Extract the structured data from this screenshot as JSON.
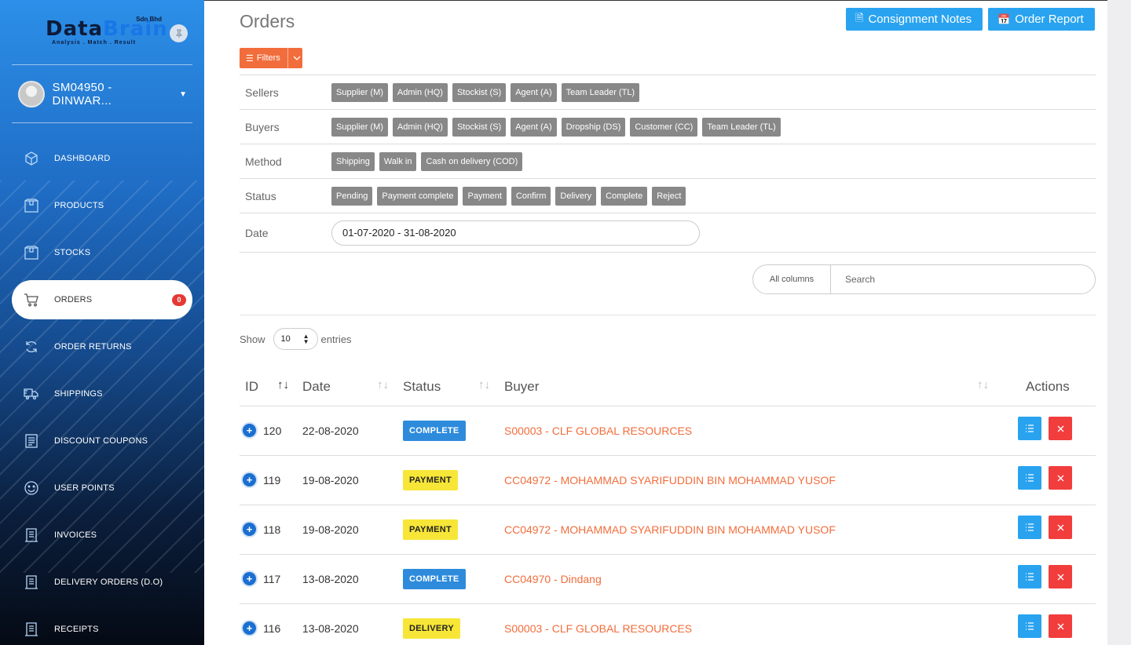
{
  "sidebar": {
    "logo": {
      "brand_dark": "Data",
      "brand_blue": "Brain",
      "sdn": "Sdn Bhd",
      "tagline": "Analysis . Match . Result"
    },
    "user_name": "SM04950 - DINWAR...",
    "items": [
      {
        "label": "DASHBOARD",
        "icon": "cube-icon"
      },
      {
        "label": "PRODUCTS",
        "icon": "box-icon"
      },
      {
        "label": "STOCKS",
        "icon": "box-icon"
      },
      {
        "label": "ORDERS",
        "icon": "cart-icon",
        "badge": "0",
        "active": true
      },
      {
        "label": "ORDER RETURNS",
        "icon": "refresh-icon"
      },
      {
        "label": "SHIPPINGS",
        "icon": "truck-icon"
      },
      {
        "label": "DISCOUNT COUPONS",
        "icon": "coupon-icon"
      },
      {
        "label": "USER POINTS",
        "icon": "smile-icon"
      },
      {
        "label": "INVOICES",
        "icon": "document-icon"
      },
      {
        "label": "DELIVERY ORDERS (D.O)",
        "icon": "document-icon"
      },
      {
        "label": "RECEIPTS",
        "icon": "document-icon"
      }
    ]
  },
  "header": {
    "title": "Orders",
    "consignment_label": "Consignment Notes",
    "report_label": "Order Report"
  },
  "filters": {
    "button_label": "Filters",
    "sellers_label": "Sellers",
    "sellers": [
      "Supplier (M)",
      "Admin (HQ)",
      "Stockist (S)",
      "Agent (A)",
      "Team Leader (TL)"
    ],
    "buyers_label": "Buyers",
    "buyers": [
      "Supplier (M)",
      "Admin (HQ)",
      "Stockist (S)",
      "Agent (A)",
      "Dropship (DS)",
      "Customer (CC)",
      "Team Leader (TL)"
    ],
    "method_label": "Method",
    "methods": [
      "Shipping",
      "Walk in",
      "Cash on delivery (COD)"
    ],
    "status_label": "Status",
    "statuses": [
      "Pending",
      "Payment complete",
      "Payment",
      "Confirm",
      "Delivery",
      "Complete",
      "Reject"
    ],
    "date_label": "Date",
    "date_value": "01-07-2020 - 31-08-2020"
  },
  "search": {
    "columns_label": "All columns",
    "placeholder": "Search"
  },
  "entries": {
    "show_label": "Show",
    "value": "10",
    "suffix": "entries"
  },
  "table": {
    "headers": {
      "id": "ID",
      "date": "Date",
      "status": "Status",
      "buyer": "Buyer",
      "actions": "Actions"
    },
    "rows": [
      {
        "id": "120",
        "date": "22-08-2020",
        "status": "COMPLETE",
        "buyer": "S00003 - CLF GLOBAL RESOURCES"
      },
      {
        "id": "119",
        "date": "19-08-2020",
        "status": "PAYMENT",
        "buyer": "CC04972 - MOHAMMAD SYARIFUDDIN BIN MOHAMMAD YUSOF"
      },
      {
        "id": "118",
        "date": "19-08-2020",
        "status": "PAYMENT",
        "buyer": "CC04972 - MOHAMMAD SYARIFUDDIN BIN MOHAMMAD YUSOF"
      },
      {
        "id": "117",
        "date": "13-08-2020",
        "status": "COMPLETE",
        "buyer": "CC04970 - Dindang"
      },
      {
        "id": "116",
        "date": "13-08-2020",
        "status": "DELIVERY",
        "buyer": "S00003 - CLF GLOBAL RESOURCES"
      }
    ]
  },
  "colors": {
    "accent_blue": "#29a3f0",
    "accent_orange": "#f26d3c",
    "status_complete": "#2e8bdc",
    "status_payment": "#f7e637",
    "danger": "#f23d3d"
  }
}
